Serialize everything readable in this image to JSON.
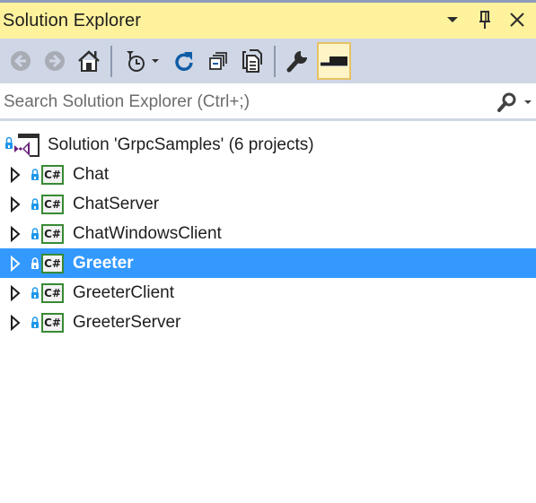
{
  "panel": {
    "title": "Solution Explorer",
    "controls": {
      "dropdown": "window-position-dropdown",
      "pin": "auto-hide-pin",
      "close": "close"
    }
  },
  "toolbar": {
    "buttons": [
      {
        "name": "back",
        "icon": "back-arrow-icon",
        "enabled": false
      },
      {
        "name": "forward",
        "icon": "forward-arrow-icon",
        "enabled": false
      },
      {
        "name": "home",
        "icon": "home-icon",
        "enabled": true
      },
      {
        "name": "pending-changes-filter",
        "icon": "clock-filter-icon",
        "enabled": true,
        "has_dropdown": true
      },
      {
        "name": "refresh",
        "icon": "refresh-icon",
        "enabled": true
      },
      {
        "name": "collapse-all",
        "icon": "collapse-all-icon",
        "enabled": true
      },
      {
        "name": "show-all-files",
        "icon": "show-all-files-icon",
        "enabled": true
      },
      {
        "name": "properties",
        "icon": "wrench-icon",
        "enabled": true
      },
      {
        "name": "preview-selected-items",
        "icon": "preview-icon",
        "enabled": true,
        "active": true
      }
    ]
  },
  "search": {
    "placeholder": "Search Solution Explorer (Ctrl+;)",
    "value": ""
  },
  "tree": {
    "solution": {
      "label": "Solution 'GrpcSamples' (6 projects)",
      "icon": "visual-studio-solution-icon"
    },
    "projects": [
      {
        "label": "Chat",
        "icon": "csharp-project-icon",
        "selected": false
      },
      {
        "label": "ChatServer",
        "icon": "csharp-project-icon",
        "selected": false
      },
      {
        "label": "ChatWindowsClient",
        "icon": "csharp-project-icon",
        "selected": false
      },
      {
        "label": "Greeter",
        "icon": "csharp-project-icon",
        "selected": true
      },
      {
        "label": "GreeterClient",
        "icon": "csharp-project-icon",
        "selected": false
      },
      {
        "label": "GreeterServer",
        "icon": "csharp-project-icon",
        "selected": false
      }
    ],
    "csharp_badge": "C#"
  },
  "colors": {
    "title_bg": "#fff29d",
    "toolbar_bg": "#cfd6e5",
    "selection": "#3399ff",
    "csharp_border": "#388a34",
    "vs_purple": "#68217a",
    "lock_blue": "#1c97ea",
    "refresh_blue": "#0e5ca6"
  }
}
